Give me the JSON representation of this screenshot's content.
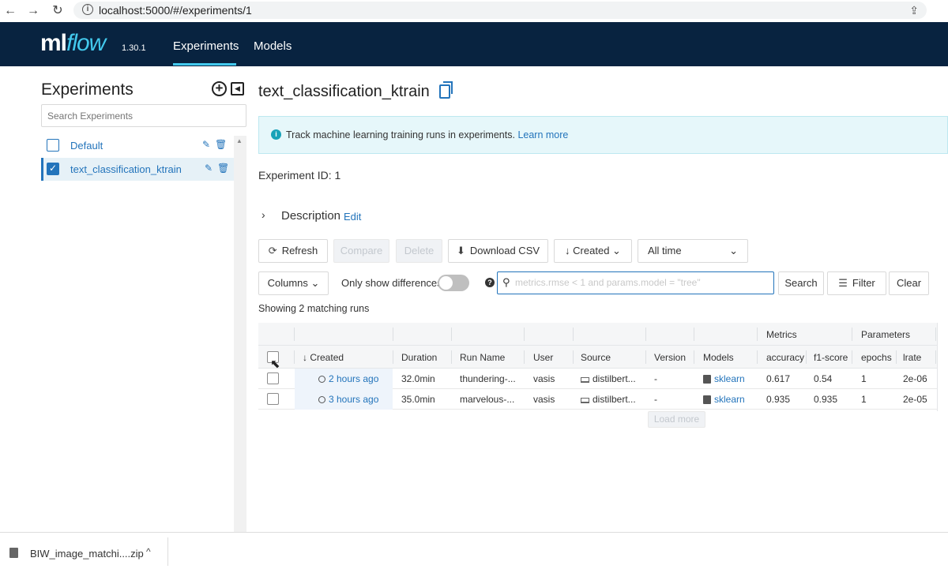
{
  "browser": {
    "back": "←",
    "forward": "→",
    "reload": "↻",
    "info": "i",
    "url": "localhost:5000/#/experiments/1",
    "share": "⇪"
  },
  "header": {
    "logo_ml": "ml",
    "logo_flow": "flow",
    "version": "1.30.1",
    "tabs": [
      "Experiments",
      "Models"
    ]
  },
  "sidebar": {
    "title": "Experiments",
    "add_icon": "+",
    "collapse_icon": "◀",
    "search_placeholder": "Search Experiments",
    "items": [
      {
        "label": "Default",
        "checked": false
      },
      {
        "label": "text_classification_ktrain",
        "checked": true
      }
    ],
    "edit_icon": "✎",
    "delete_icon": "🗑",
    "check_mark": "✓",
    "scroll_up": "▲"
  },
  "main": {
    "title": "text_classification_ktrain",
    "info_icon": "i",
    "info_text": "Track machine learning training runs in experiments.",
    "info_link": "Learn more",
    "experiment_id_label": "Experiment ID:",
    "experiment_id": "1",
    "description_chevron": "›",
    "description_label": "Description",
    "description_edit": "Edit",
    "toolbar": {
      "refresh": "Refresh",
      "refresh_icon": "⟳",
      "compare": "Compare",
      "delete": "Delete",
      "download_csv": "Download CSV",
      "download_icon": "⬇",
      "sort": "Created",
      "sort_icon": "↓",
      "sort_chevron": "⌄",
      "time_range": "All time",
      "time_chevron": "⌄",
      "columns": "Columns",
      "columns_chevron": "⌄",
      "only_show_differences": "Only show differences",
      "help_icon": "?",
      "search_icon": "⚲",
      "search_placeholder": "metrics.rmse < 1 and params.model = \"tree\"",
      "search_button": "Search",
      "filter_button": "Filter",
      "filter_icon": "☰",
      "clear_button": "Clear"
    },
    "showing": "Showing 2 matching runs",
    "table": {
      "group_headers": {
        "metrics": "Metrics",
        "parameters": "Parameters"
      },
      "sort_arrow": "↓",
      "columns": [
        "Created",
        "Duration",
        "Run Name",
        "User",
        "Source",
        "Version",
        "Models",
        "accuracy",
        "f1-score",
        "epochs",
        "lrate"
      ],
      "rows": [
        {
          "created": "2 hours ago",
          "duration": "32.0min",
          "run_name": "thundering-...",
          "user": "vasis",
          "source": "distilbert...",
          "version": "-",
          "models": "sklearn",
          "accuracy": "0.617",
          "f1_score": "0.54",
          "epochs": "1",
          "lrate": "2e-06"
        },
        {
          "created": "3 hours ago",
          "duration": "35.0min",
          "run_name": "marvelous-...",
          "user": "vasis",
          "source": "distilbert...",
          "version": "-",
          "models": "sklearn",
          "accuracy": "0.935",
          "f1_score": "0.935",
          "epochs": "1",
          "lrate": "2e-05"
        }
      ],
      "load_more": "Load more"
    }
  },
  "download_bar": {
    "filename": "BIW_image_matchi....zip",
    "chevron": "^"
  },
  "cursor": "⬉"
}
